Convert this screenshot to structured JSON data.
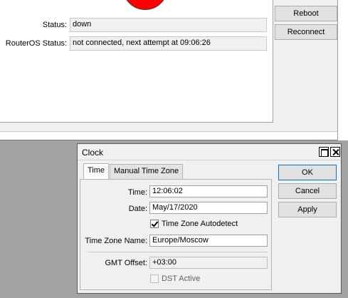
{
  "background_window": {
    "status_label": "Status:",
    "status_value": "down",
    "routeros_status_label": "RouterOS Status:",
    "routeros_status_value": "not connected, next attempt at 09:06:26",
    "reboot_label": "Reboot",
    "reconnect_label": "Reconnect",
    "indicator_color": "#ff0000"
  },
  "dialog": {
    "title": "Clock",
    "tabs": [
      {
        "label": "Time",
        "active": true
      },
      {
        "label": "Manual Time Zone",
        "active": false
      }
    ],
    "fields": {
      "time_label": "Time:",
      "time_value": "12:06:02",
      "date_label": "Date:",
      "date_value": "May/17/2020",
      "tz_autodetect_label": "Time Zone Autodetect",
      "tz_autodetect_checked": true,
      "tz_name_label": "Time Zone Name:",
      "tz_name_value": "Europe/Moscow",
      "gmt_offset_label": "GMT Offset:",
      "gmt_offset_value": "+03:00",
      "dst_active_label": "DST Active",
      "dst_active_checked": false
    },
    "buttons": {
      "ok_label": "OK",
      "cancel_label": "Cancel",
      "apply_label": "Apply"
    }
  }
}
